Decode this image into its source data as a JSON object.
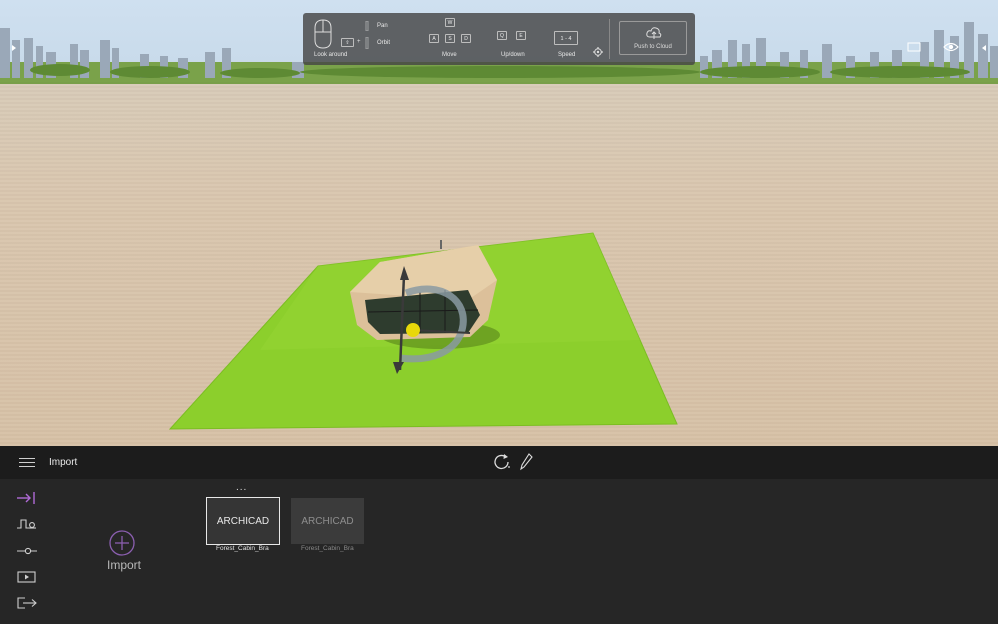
{
  "toolbar": {
    "look_around": "Look around",
    "pan": "Pan",
    "orbit": "Orbit",
    "move": "Move",
    "up_down": "Up/down",
    "speed": "Speed",
    "speed_value": "1 - 4",
    "push_to_cloud": "Push to Cloud",
    "keys": {
      "w": "W",
      "a": "A",
      "s": "S",
      "d": "D",
      "q": "Q",
      "e": "E",
      "shift": "⇧"
    }
  },
  "panel": {
    "title": "Import",
    "import_label": "Import",
    "more": "...",
    "tiles": [
      {
        "label": "ARCHICAD",
        "caption": "Forest_Cabin_Bra",
        "selected": true
      },
      {
        "label": "ARCHICAD",
        "caption": "Forest_Cabin_Bra",
        "selected": false
      }
    ]
  },
  "colors": {
    "accent": "#b06ad6",
    "grass": "#8ccf2c",
    "ground": "#d8c4a9",
    "panel": "#262626",
    "panel_header": "#1c1c1c"
  }
}
